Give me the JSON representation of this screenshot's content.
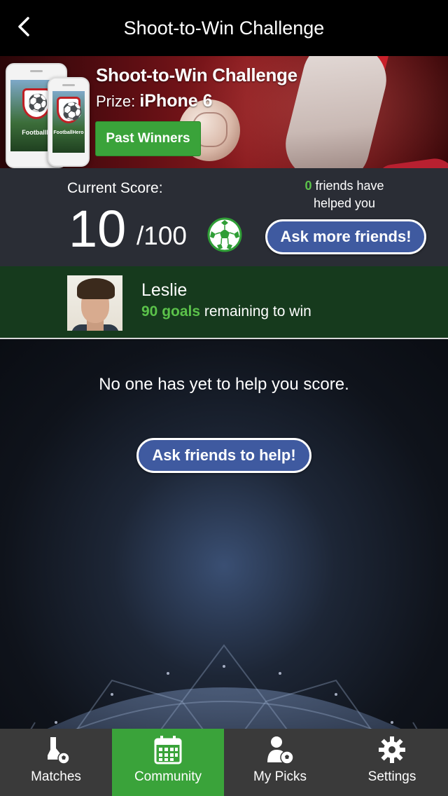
{
  "navbar": {
    "title": "Shoot-to-Win Challenge",
    "back_icon": "chevron-left-icon"
  },
  "banner": {
    "title": "Shoot-to-Win Challenge",
    "prize_label": "Prize:",
    "prize_value": "iPhone 6",
    "past_winners_label": "Past Winners",
    "phone_brand_left": "FootballH",
    "phone_brand_right": "FootballHero"
  },
  "score": {
    "label": "Current Score:",
    "current": "10",
    "total": "/100",
    "friends_count": "0",
    "friends_text_1": " friends have",
    "friends_text_2": "helped you",
    "ask_more_label": "Ask more friends!",
    "ball_icon": "soccer-ball-icon"
  },
  "player": {
    "name": "Leslie",
    "goals": "90 goals",
    "remaining_text": " remaining to win"
  },
  "main": {
    "empty_message": "No one has yet to help you score.",
    "ask_help_label": "Ask friends to help!"
  },
  "tabs": [
    {
      "label": "Matches",
      "icon": "cleat-ball-icon",
      "active": false
    },
    {
      "label": "Community",
      "icon": "calendar-icon",
      "active": true
    },
    {
      "label": "My Picks",
      "icon": "user-ball-icon",
      "active": false
    },
    {
      "label": "Settings",
      "icon": "gear-icon",
      "active": false
    }
  ],
  "colors": {
    "accent_green": "#3aa33a",
    "highlight_green": "#5bc24a",
    "button_blue": "#3f5aa0",
    "navbar": "#000000",
    "tabbar": "#3a3a3a"
  }
}
